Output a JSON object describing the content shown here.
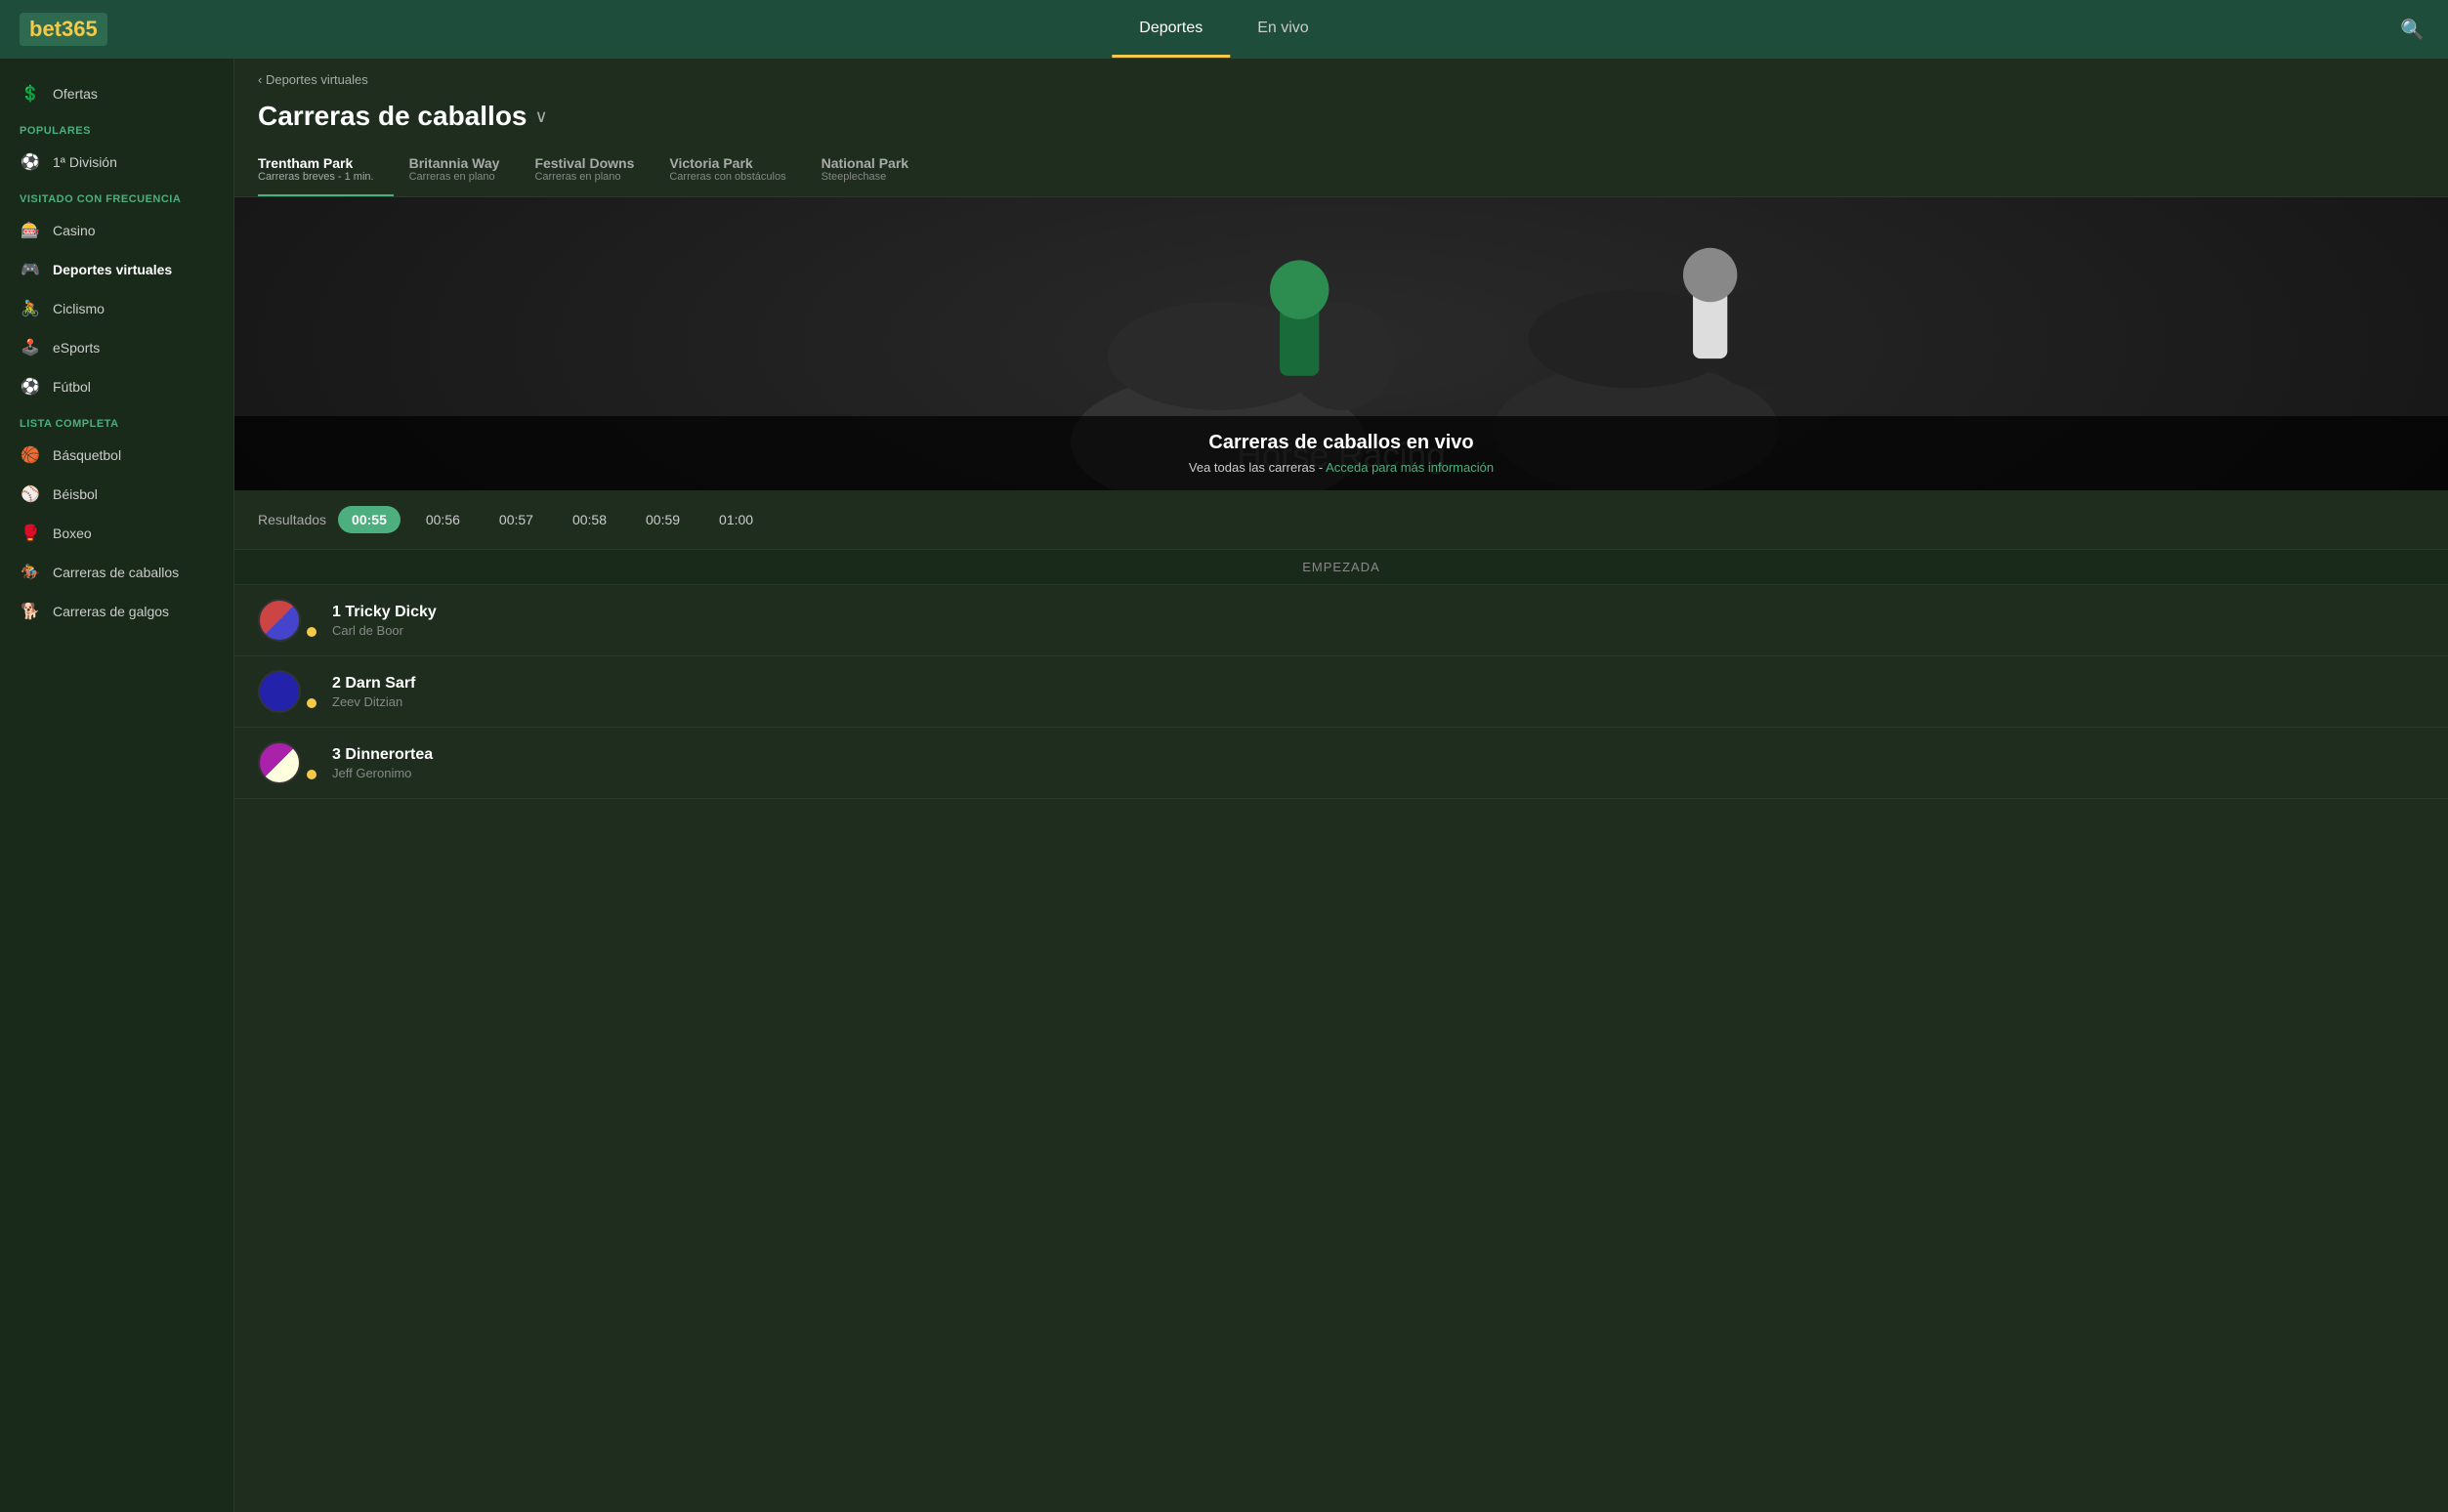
{
  "logo": {
    "text": "bet",
    "highlight": "365"
  },
  "nav": {
    "tabs": [
      {
        "label": "Deportes",
        "active": true
      },
      {
        "label": "En vivo",
        "active": false
      }
    ]
  },
  "sidebar": {
    "sections": [
      {
        "title": "POPULARES",
        "items": [
          {
            "id": "primera-division",
            "icon": "⚽",
            "label": "1ª División",
            "active": false
          },
          {
            "id": "ofertas",
            "icon": "💰",
            "label": "Ofertas",
            "active": false
          }
        ]
      },
      {
        "title": "VISITADO CON FRECUENCIA",
        "items": [
          {
            "id": "casino",
            "icon": "🎰",
            "label": "Casino",
            "active": false
          },
          {
            "id": "deportes-virtuales",
            "icon": "🎮",
            "label": "Deportes virtuales",
            "active": true
          },
          {
            "id": "ciclismo",
            "icon": "🚴",
            "label": "Ciclismo",
            "active": false
          },
          {
            "id": "esports",
            "icon": "🕹️",
            "label": "eSports",
            "active": false
          },
          {
            "id": "futbol",
            "icon": "⚽",
            "label": "Fútbol",
            "active": false
          }
        ]
      },
      {
        "title": "LISTA COMPLETA",
        "items": [
          {
            "id": "basquetbol",
            "icon": "🏀",
            "label": "Básquetbol",
            "active": false
          },
          {
            "id": "beisbol",
            "icon": "⚾",
            "label": "Béisbol",
            "active": false
          },
          {
            "id": "boxeo",
            "icon": "🥊",
            "label": "Boxeo",
            "active": false
          },
          {
            "id": "carreras-caballos",
            "icon": "🏇",
            "label": "Carreras de caballos",
            "active": false
          },
          {
            "id": "carreras-galgos",
            "icon": "🐕",
            "label": "Carreras de galgos",
            "active": false
          }
        ]
      }
    ]
  },
  "breadcrumb": "Deportes virtuales",
  "page": {
    "title": "Carreras de caballos",
    "dropdown_icon": "∨"
  },
  "tracks": [
    {
      "id": "trentham",
      "name": "Trentham Park",
      "sub": "Carreras breves - 1 min.",
      "active": true
    },
    {
      "id": "britannia",
      "name": "Britannia Way",
      "sub": "Carreras en plano",
      "active": false
    },
    {
      "id": "festival",
      "name": "Festival Downs",
      "sub": "Carreras en plano",
      "active": false
    },
    {
      "id": "victoria",
      "name": "Victoria Park",
      "sub": "Carreras con obstáculos",
      "active": false
    },
    {
      "id": "national",
      "name": "National Park",
      "sub": "Steeplechase",
      "active": false
    }
  ],
  "hero": {
    "title": "Carreras de caballos en vivo",
    "sub_text": "Vea todas las carreras - ",
    "link_text": "Acceda para más información"
  },
  "times": {
    "label": "Resultados",
    "slots": [
      {
        "value": "00:55",
        "active": true
      },
      {
        "value": "00:56",
        "active": false
      },
      {
        "value": "00:57",
        "active": false
      },
      {
        "value": "00:58",
        "active": false
      },
      {
        "value": "00:59",
        "active": false
      },
      {
        "value": "01:00",
        "active": false
      }
    ]
  },
  "race_status": "EMPEZADA",
  "horses": [
    {
      "number": "1",
      "name": "Tricky Dicky",
      "jockey": "Carl de Boor",
      "silks_class": "silks-1"
    },
    {
      "number": "2",
      "name": "Darn Sarf",
      "jockey": "Zeev Ditzian",
      "silks_class": "silks-2"
    },
    {
      "number": "3",
      "name": "Dinnerortea",
      "jockey": "Jeff Geronimo",
      "silks_class": "silks-3"
    }
  ]
}
